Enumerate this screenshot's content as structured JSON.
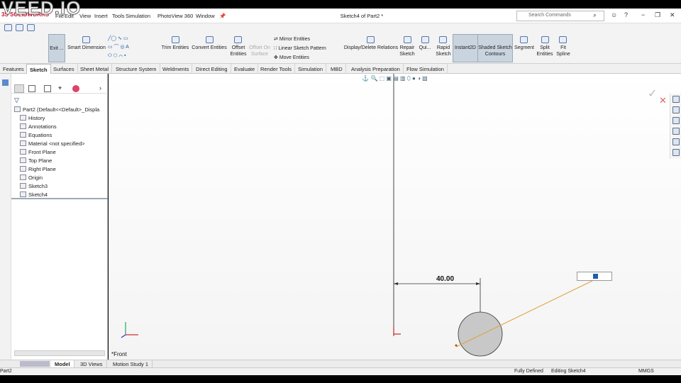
{
  "watermark": "VEED.IO",
  "app": {
    "logo": "3S SOLIDWORKS"
  },
  "menu": [
    "File",
    "Edit",
    "View",
    "Insert",
    "Tools",
    "Simulation",
    "PhotoView 360",
    "Window"
  ],
  "title": "Sketch4 of Part2 *",
  "search": {
    "placeholder": "Search Commands"
  },
  "ribbon": {
    "exit": "Exit ...",
    "smart_dimension": "Smart Dimension",
    "trim": "Trim Entities",
    "convert": "Convert Entities",
    "offset": "Offset Entities",
    "offset_surface": "Offset On Surface",
    "mirror": "Mirror Entities",
    "linear_pattern": "Linear Sketch Pattern",
    "move": "Move Entities",
    "display_relations": "Display/Delete Relations",
    "repair": "Repair Sketch",
    "quick": "Qui...",
    "rapid": "Rapid Sketch",
    "instant2d": "Instant2D",
    "shaded": "Shaded Sketch Contours",
    "segment": "Segment",
    "split": "Split Entities",
    "fit_spline": "Fit Spline"
  },
  "tabs": [
    "Features",
    "Sketch",
    "Surfaces",
    "Sheet Metal",
    "Structure System",
    "Weldments",
    "Direct Editing",
    "Evaluate",
    "Render Tools",
    "Simulation",
    "MBD",
    "Analysis Preparation",
    "Flow Simulation"
  ],
  "tree": {
    "root": "Part2  (Default<<Default>_Displa",
    "items": [
      "History",
      "Annotations",
      "Equations",
      "Material <not specified>",
      "Front Plane",
      "Top Plane",
      "Right Plane",
      "Origin",
      "Sketch3",
      "Sketch4"
    ]
  },
  "view": {
    "orientation": "*Front",
    "dimension": "40.00"
  },
  "bottom_tabs": [
    "Model",
    "3D Views",
    "Motion Study 1"
  ],
  "status": {
    "doc": "Part2",
    "state": "Fully Defined",
    "editing": "Editing Sketch4",
    "units": "MMGS"
  },
  "colors": {
    "accent": "#1f5fa8",
    "sketch_line": "#e0a040",
    "origin": "#d02020",
    "circle_fill": "#c8c8c8"
  }
}
